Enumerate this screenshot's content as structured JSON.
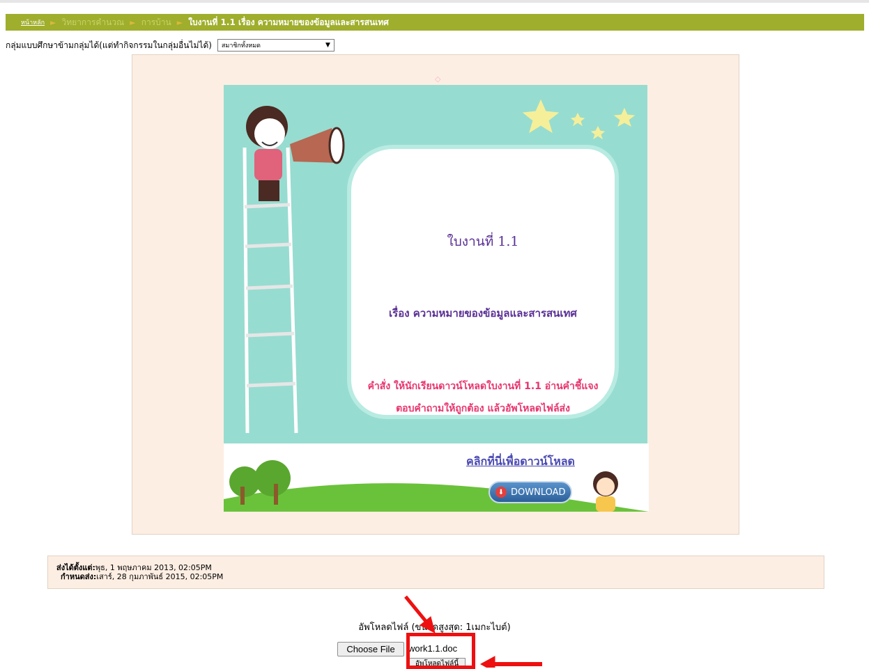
{
  "breadcrumb": {
    "home": "หน้าหลัก",
    "course": "วิทยาการคำนวณ",
    "section": "การบ้าน",
    "current": "ใบงานที่ 1.1 เรื่อง ความหมายของข้อมูลและสารสนเทศ"
  },
  "group_mode": {
    "label": "กลุ่มแบบศึกษาข้ามกลุ่มได้(แต่ทำกิจกรรมในกลุ่มอื่นไม่ได้)",
    "selected": "สมาชิกทั้งหมด",
    "arrow": "▼"
  },
  "worksheet": {
    "title": "ใบงานที่ 1.1",
    "subject": "เรื่อง ความหมายของข้อมูลและสารสนเทศ",
    "instruction_line1": "คำสั่ง  ให้นักเรียนดาวน์โหลดใบงานที่ 1.1 อ่านคำชี้แจง",
    "instruction_line2": "ตอบคำถามให้ถูกต้อง แล้วอัพโหลดไฟล์ส่ง",
    "click_here": "คลิกที่นี่เพื่อดาวน์โหลด",
    "download_label": "DOWNLOAD",
    "diamond": "◇"
  },
  "dates": {
    "available_label": "ส่งได้ตั้งแต่:",
    "available_value": "พุธ, 1 พฤษภาคม 2013, 02:05PM",
    "due_label": "กำหนดส่ง:",
    "due_value": "เสาร์, 28 กุมภาพันธ์ 2015, 02:05PM"
  },
  "upload": {
    "label": "อัพโหลดไฟล์ (ขนาดสูงสุด: 1เมกะไบต์)",
    "choose_button": "Choose File",
    "file_name": "work1.1.doc",
    "submit_button": "อัพโหลดไฟล์นี้"
  },
  "colors": {
    "breadcrumb_bg": "#9fae2c",
    "panel_bg": "#fdeee3",
    "worksheet_bg": "#97dcd0",
    "title_purple": "#5a2f95",
    "instruction_pink": "#e8356e",
    "annotation_red": "#ee1010"
  }
}
